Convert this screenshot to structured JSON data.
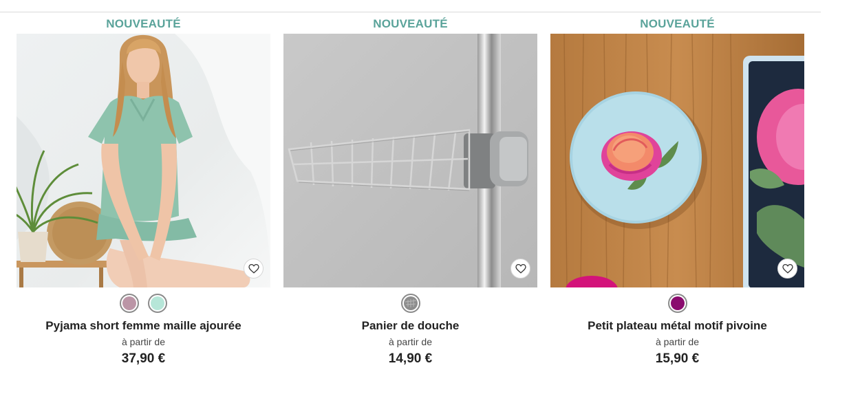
{
  "colors": {
    "accent": "#5aa39a",
    "swatch_ring": "#8a8a8a",
    "text": "#222222"
  },
  "favorite_icon": "heart-icon",
  "products": [
    {
      "badge": "NOUVEAUTÉ",
      "image": "woman-in-mint-pyjama-photo",
      "swatches": [
        {
          "color": "#bb95a6"
        },
        {
          "color": "#b6e6d8"
        }
      ],
      "name": "Pyjama short femme maille ajourée",
      "price_prefix": "à partir de",
      "price": "37,90 €"
    },
    {
      "badge": "NOUVEAUTÉ",
      "image": "shower-basket-photo",
      "swatches": [
        {
          "color": "#8d8d8d"
        }
      ],
      "name": "Panier de douche",
      "price_prefix": "à partir de",
      "price": "14,90 €"
    },
    {
      "badge": "NOUVEAUTÉ",
      "image": "peony-metal-tray-photo",
      "swatches": [
        {
          "color": "#8a0b6e"
        }
      ],
      "name": "Petit plateau métal motif pivoine",
      "price_prefix": "à partir de",
      "price": "15,90 €"
    }
  ]
}
